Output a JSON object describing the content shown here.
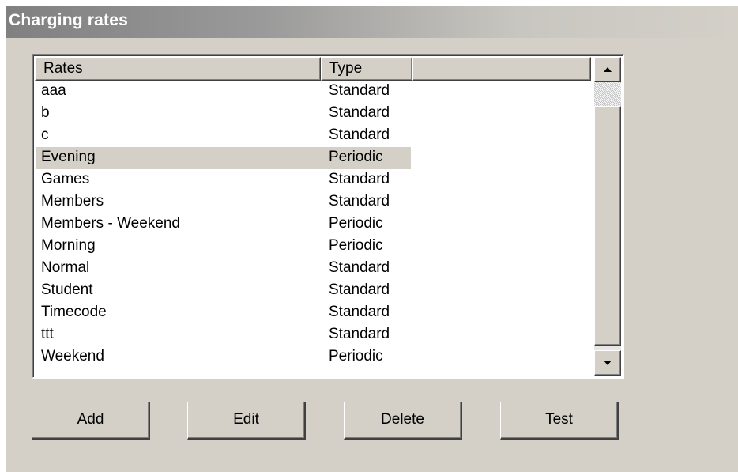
{
  "window": {
    "title": "Charging rates"
  },
  "listview": {
    "columns": [
      "Rates",
      "Type",
      ""
    ],
    "rows": [
      {
        "name": "aaa",
        "type": "Standard"
      },
      {
        "name": "b",
        "type": "Standard"
      },
      {
        "name": "c",
        "type": "Standard"
      },
      {
        "name": "Evening",
        "type": "Periodic",
        "selected": true
      },
      {
        "name": "Games",
        "type": "Standard"
      },
      {
        "name": "Members",
        "type": "Standard"
      },
      {
        "name": "Members - Weekend",
        "type": "Periodic"
      },
      {
        "name": "Morning",
        "type": "Periodic"
      },
      {
        "name": "Normal",
        "type": "Standard"
      },
      {
        "name": "Student",
        "type": "Standard"
      },
      {
        "name": "Timecode",
        "type": "Standard"
      },
      {
        "name": "ttt",
        "type": "Standard"
      },
      {
        "name": "Weekend",
        "type": "Periodic"
      }
    ]
  },
  "scrollbar": {
    "up_icon": "arrow-up-icon",
    "down_icon": "arrow-down-icon"
  },
  "buttons": {
    "add": {
      "mnemonic": "A",
      "rest": "dd"
    },
    "edit": {
      "mnemonic": "E",
      "rest": "dit"
    },
    "delete": {
      "mnemonic": "D",
      "rest": "elete"
    },
    "test": {
      "mnemonic": "T",
      "rest": "est"
    }
  },
  "colors": {
    "face": "#d4d0c8",
    "selection": "#d4d0c8"
  }
}
